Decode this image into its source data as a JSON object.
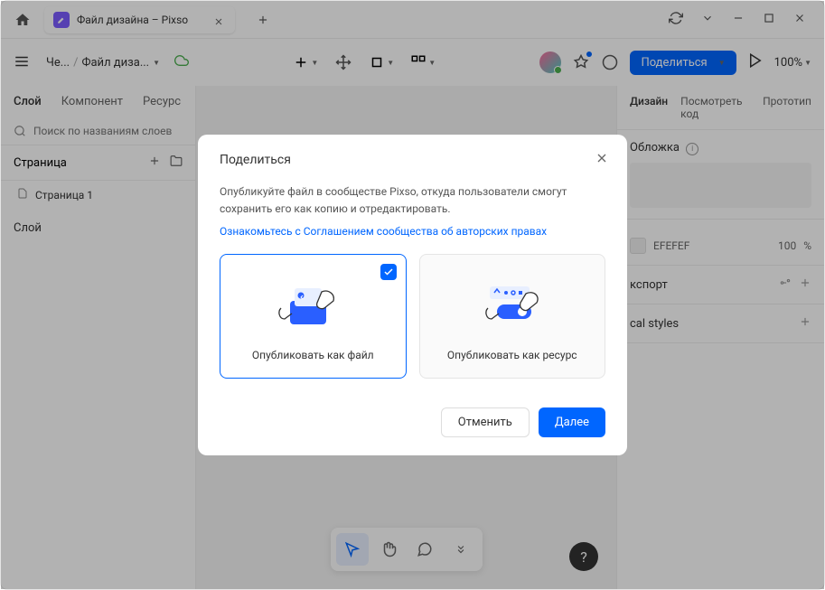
{
  "titlebar": {
    "tab_title": "Файл дизайна – Pixso"
  },
  "toolbar": {
    "breadcrumb_first": "Че...",
    "breadcrumb_second": "Файл диза...",
    "share_label": "Поделиться",
    "zoom_label": "100%"
  },
  "left_panel": {
    "tab_layer": "Слой",
    "tab_component": "Компонент",
    "tab_resource": "Ресурс",
    "search_placeholder": "Поиск по названиям слоев",
    "page_label": "Страница",
    "page_item": "Страница 1",
    "layers_label": "Слой"
  },
  "right_panel": {
    "tab_design": "Дизайн",
    "tab_code": "Посмотреть код",
    "tab_prototype": "Прототип",
    "cover_label": "Обложка",
    "color_hex": "EFEFEF",
    "opacity_value": "100",
    "opacity_unit": "%",
    "export_label": "кспорт",
    "styles_label": "cal styles"
  },
  "modal": {
    "title": "Поделиться",
    "description": "Опубликуйте файл в сообществе Pixso, откуда пользователи смогут сохранить его как копию и отредактировать.",
    "link_text": "Ознакомьтесь с Соглашением сообщества об авторских правах",
    "option1_label": "Опубликовать как файл",
    "option2_label": "Опубликовать как ресурс",
    "cancel_label": "Отменить",
    "next_label": "Далее"
  },
  "help_icon": "?"
}
